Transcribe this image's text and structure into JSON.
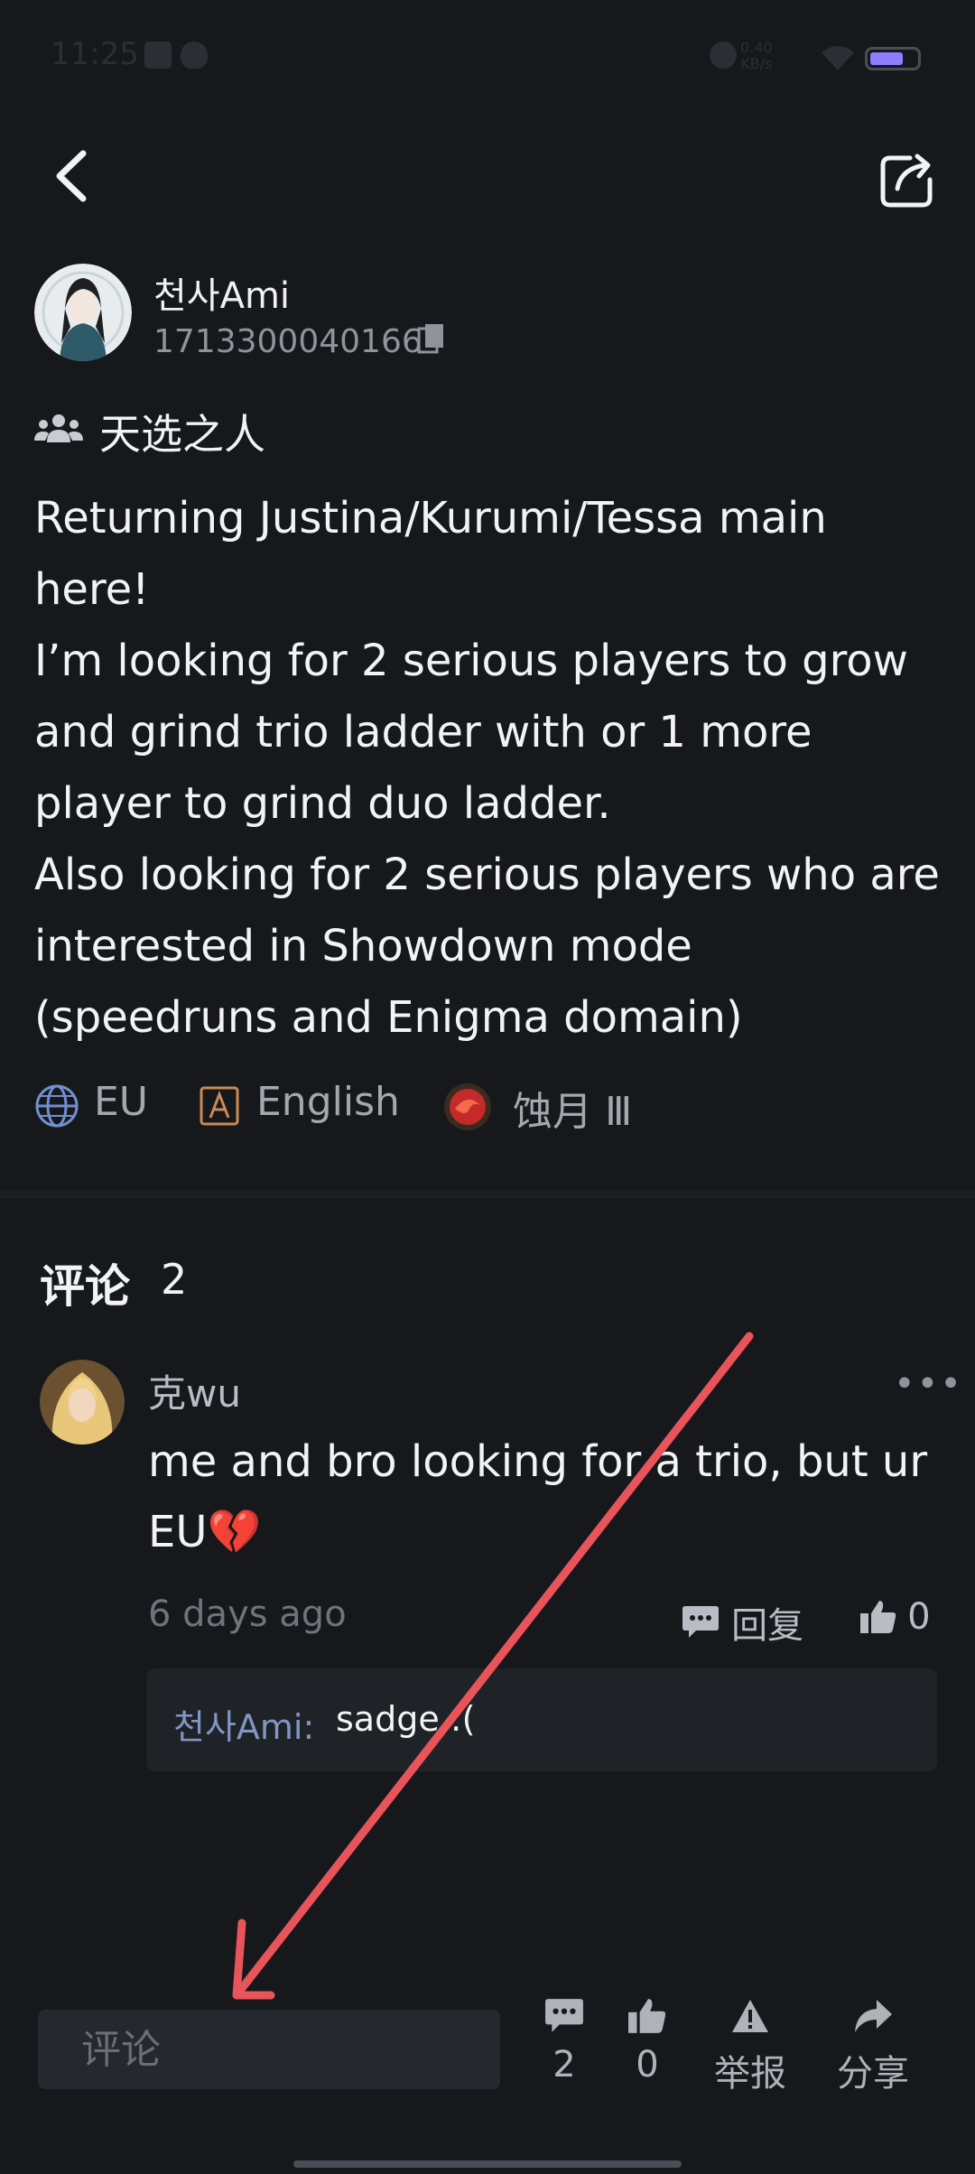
{
  "status_bar": {
    "time": "11:25",
    "net_speed": "0.40\nKB/s",
    "battery_level": 0.72
  },
  "author": {
    "name": "천사Ami",
    "id": "1713300040166"
  },
  "tag": {
    "label": "天选之人"
  },
  "post": {
    "body": "Returning Justina/Kurumi/Tessa main\nhere!\nI’m looking for 2 serious players to grow\nand grind trio ladder with or 1 more\nplayer to grind duo ladder.\nAlso looking for 2 serious players who are\ninterested in Showdown mode\n(speedruns and Enigma domain)"
  },
  "meta": {
    "region": "EU",
    "language": "English",
    "rank": "蚀月 Ⅲ"
  },
  "comments": {
    "title": "评论",
    "count": "2",
    "items": [
      {
        "user": "克wu",
        "text": "me and bro looking for a trio, but ur EU💔",
        "time": "6 days ago",
        "reply_label": "回复",
        "likes": "0",
        "replies": [
          {
            "user": "천사Ami:",
            "text": "sadge :("
          }
        ]
      }
    ]
  },
  "bottom_bar": {
    "comment_placeholder": "评论",
    "comment_count": "2",
    "like_count": "0",
    "report_label": "举报",
    "share_label": "分享"
  },
  "colors": {
    "background": "#16181c",
    "annotation_arrow": "#e9545a",
    "reply_user": "#7f97c2"
  }
}
